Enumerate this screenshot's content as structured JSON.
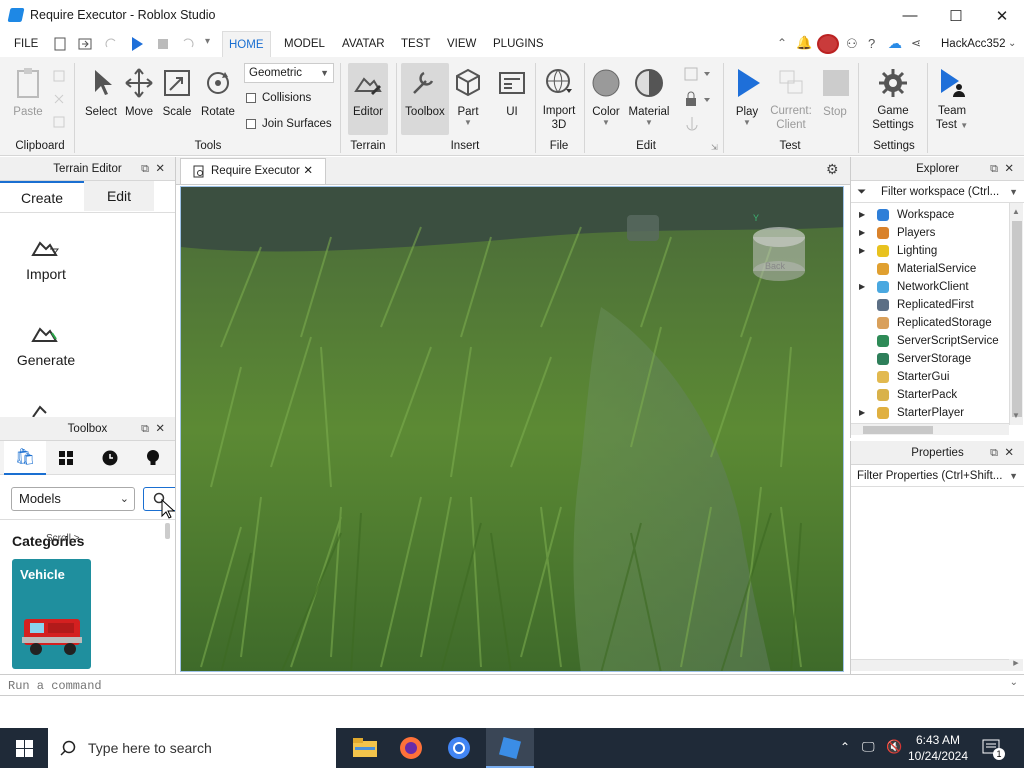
{
  "window": {
    "title": "Require Executor - Roblox Studio",
    "minimize": "—",
    "maximize": "☐",
    "close": "✕"
  },
  "menubar": {
    "items": [
      "FILE",
      "HOME",
      "MODEL",
      "AVATAR",
      "TEST",
      "VIEW",
      "PLUGINS"
    ],
    "active": "HOME",
    "user": "HackAcc352"
  },
  "ribbon": {
    "clipboard": {
      "paste": "Paste",
      "group": "Clipboard"
    },
    "tools": {
      "select": "Select",
      "move": "Move",
      "scale": "Scale",
      "rotate": "Rotate",
      "dropdown": "Geometric",
      "collisions": "Collisions",
      "join": "Join Surfaces",
      "group": "Tools"
    },
    "terrain": {
      "editor": "Editor",
      "group": "Terrain"
    },
    "insert": {
      "toolbox": "Toolbox",
      "part": "Part",
      "ui": "UI",
      "group": "Insert"
    },
    "file": {
      "import1": "Import",
      "import2": "3D",
      "group": "File"
    },
    "edit": {
      "color": "Color",
      "material": "Material",
      "group": "Edit"
    },
    "test": {
      "play": "Play",
      "current1": "Current:",
      "current2": "Client",
      "stop": "Stop",
      "group": "Test"
    },
    "settings": {
      "game1": "Game",
      "game2": "Settings",
      "group": "Settings"
    },
    "team": {
      "t1": "Team",
      "t2": "Test"
    }
  },
  "terrain_editor": {
    "title": "Terrain Editor",
    "tabs": [
      "Create",
      "Edit"
    ],
    "items": [
      "Import",
      "Generate"
    ]
  },
  "toolbox": {
    "title": "Toolbox",
    "dropdown": "Models",
    "categories_label": "Categories",
    "scroll_hint": "Scroll >",
    "card_label": "Vehicle"
  },
  "document_tab": {
    "label": "Require Executor"
  },
  "viewport": {
    "gizmo_label": "Back",
    "gizmo_axis": "Y"
  },
  "explorer": {
    "title": "Explorer",
    "filter": "Filter workspace (Ctrl...",
    "items": [
      {
        "name": "Workspace",
        "expand": true,
        "icon": "globe-icon"
      },
      {
        "name": "Players",
        "expand": true,
        "icon": "players-icon"
      },
      {
        "name": "Lighting",
        "expand": true,
        "icon": "lightbulb-icon"
      },
      {
        "name": "MaterialService",
        "expand": false,
        "icon": "material-icon"
      },
      {
        "name": "NetworkClient",
        "expand": true,
        "icon": "network-icon"
      },
      {
        "name": "ReplicatedFirst",
        "expand": false,
        "icon": "replicated-first-icon"
      },
      {
        "name": "ReplicatedStorage",
        "expand": false,
        "icon": "replicated-storage-icon"
      },
      {
        "name": "ServerScriptService",
        "expand": false,
        "icon": "server-script-icon"
      },
      {
        "name": "ServerStorage",
        "expand": false,
        "icon": "server-storage-icon"
      },
      {
        "name": "StarterGui",
        "expand": false,
        "icon": "folder-icon"
      },
      {
        "name": "StarterPack",
        "expand": false,
        "icon": "starter-pack-icon"
      },
      {
        "name": "StarterPlayer",
        "expand": true,
        "icon": "starter-player-icon"
      }
    ]
  },
  "properties": {
    "title": "Properties",
    "filter": "Filter Properties (Ctrl+Shift..."
  },
  "command_bar": {
    "placeholder": "Run a command"
  },
  "taskbar": {
    "search": "Type here to search",
    "time": "6:43 AM",
    "date": "10/24/2024",
    "notif_count": "1"
  },
  "colors": {
    "accent": "#1a6fd1",
    "taskbar": "#1f2a38",
    "grass": "#4f7a2c"
  }
}
